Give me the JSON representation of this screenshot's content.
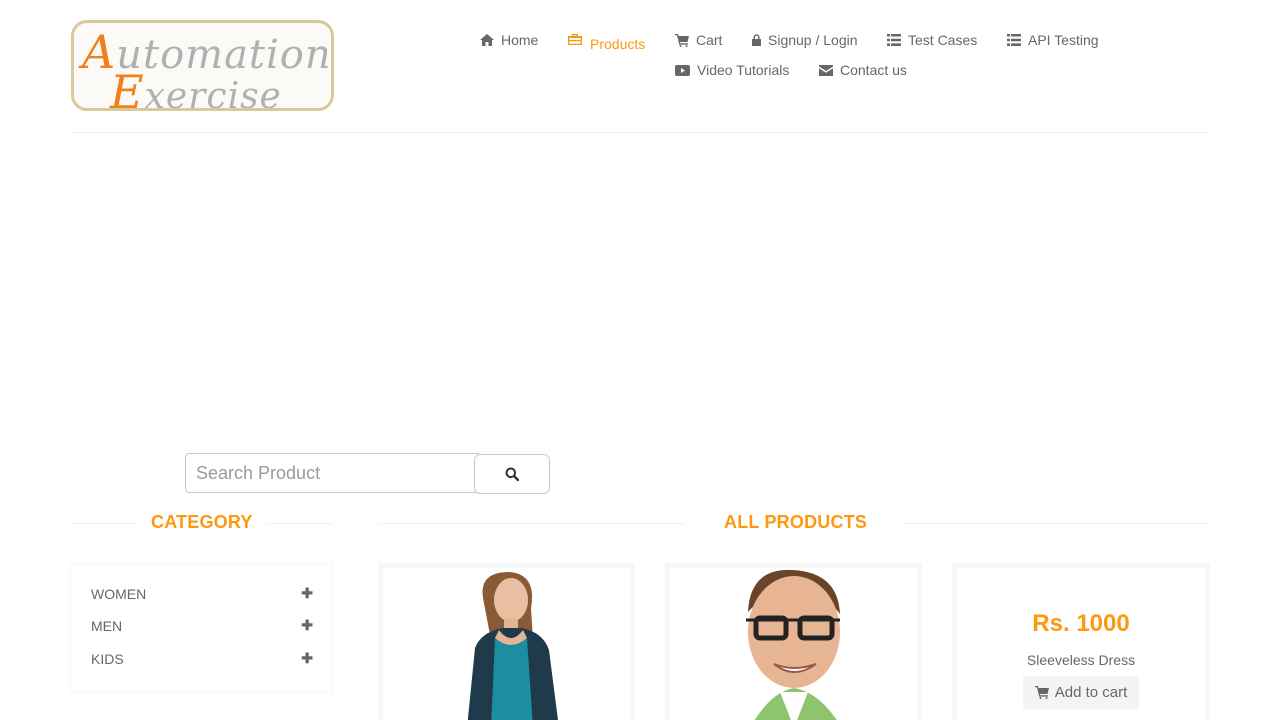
{
  "logo": {
    "line1_first": "A",
    "line1_rest": "utomation",
    "line2_first": "E",
    "line2_rest": "xercise"
  },
  "nav": {
    "home": "Home",
    "products": "Products",
    "cart": "Cart",
    "signup_login": "Signup / Login",
    "test_cases": "Test Cases",
    "api_testing": "API Testing",
    "video_tutorials": "Video Tutorials",
    "contact_us": "Contact us"
  },
  "search": {
    "placeholder": "Search Product"
  },
  "sidebar": {
    "title": "CATEGORY",
    "items": [
      {
        "label": "WOMEN"
      },
      {
        "label": "MEN"
      },
      {
        "label": "KIDS"
      }
    ]
  },
  "products": {
    "title": "ALL PRODUCTS",
    "items": [
      {
        "image": "woman-teal-top"
      },
      {
        "image": "man-glasses"
      },
      {
        "price": "Rs. 1000",
        "name": "Sleeveless Dress",
        "button": "Add to cart"
      }
    ]
  },
  "colors": {
    "accent": "#fe980f",
    "text": "#696763"
  }
}
